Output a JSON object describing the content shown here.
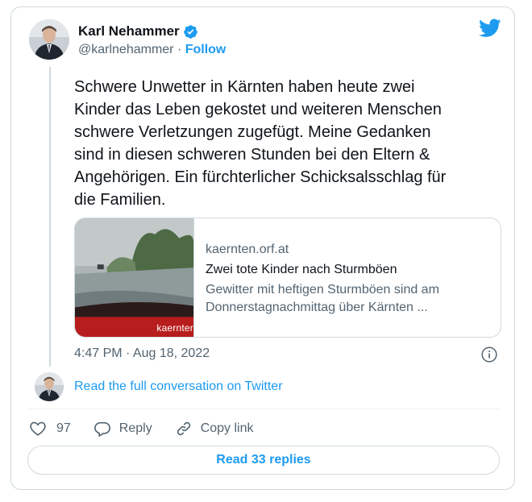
{
  "author": {
    "display_name": "Karl Nehammer",
    "handle": "@karlnehammer",
    "separator": " · ",
    "follow_label": "Follow"
  },
  "tweet": {
    "text": "Schwere Unwetter in Kärnten haben heute zwei\nKinder das Leben gekostet und weiteren Menschen\nschwere Verletzungen zugefügt. Meine Gedanken\nsind in diesen schweren Stunden bei den Eltern &\nAngehörigen. Ein fürchterlicher Schicksalsschlag für\ndie Familien.",
    "timestamp": "4:47 PM · Aug 18, 2022"
  },
  "link_card": {
    "thumb_caption": "kaernter",
    "domain": "kaernten.orf.at",
    "title": "Zwei tote Kinder nach Sturmböen",
    "description": "Gewitter mit heftigen Sturmböen sind am\nDonnerstagnachmittag über Kärnten ..."
  },
  "conversation_link": "Read the full conversation on Twitter",
  "actions": {
    "like_count": "97",
    "reply_label": "Reply",
    "copy_label": "Copy link"
  },
  "read_replies_label": "Read 33 replies",
  "colors": {
    "accent": "#1d9bf0",
    "text": "#0f1419",
    "muted": "#536471",
    "border": "#cfd9de"
  },
  "icons": [
    "verified-badge-icon",
    "twitter-bird-icon",
    "info-icon",
    "heart-icon",
    "reply-bubble-icon",
    "link-icon"
  ]
}
